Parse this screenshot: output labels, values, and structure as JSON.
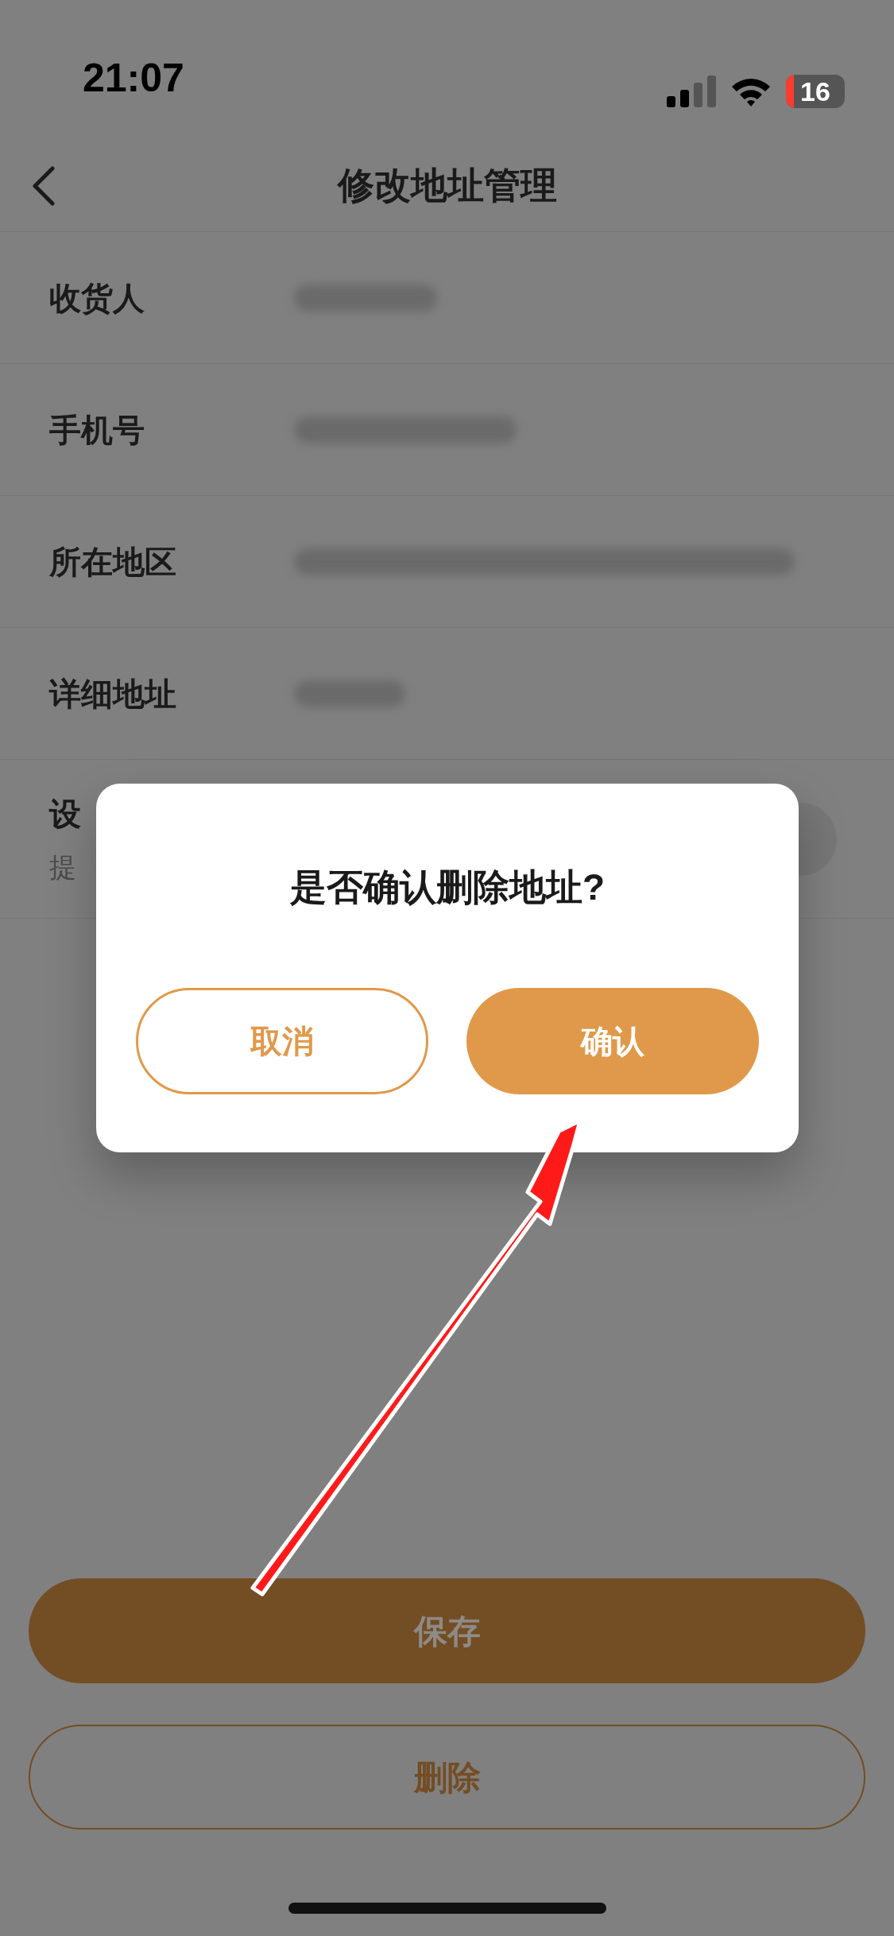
{
  "status_bar": {
    "time": "21:07",
    "battery": "16"
  },
  "nav": {
    "title": "修改地址管理"
  },
  "form": {
    "rows": [
      {
        "label": "收货人"
      },
      {
        "label": "手机号"
      },
      {
        "label": "所在地区"
      },
      {
        "label": "详细地址"
      }
    ],
    "default_row": {
      "label": "设",
      "hint": "提",
      "on": false
    }
  },
  "dialog": {
    "message": "是否确认删除地址?",
    "buttons": [
      {
        "label": "取消",
        "kind": "outline"
      },
      {
        "label": "确认",
        "kind": "filled"
      }
    ]
  },
  "actions": [
    {
      "label": "保存",
      "kind": "filled"
    },
    {
      "label": "删除",
      "kind": "outline"
    }
  ]
}
